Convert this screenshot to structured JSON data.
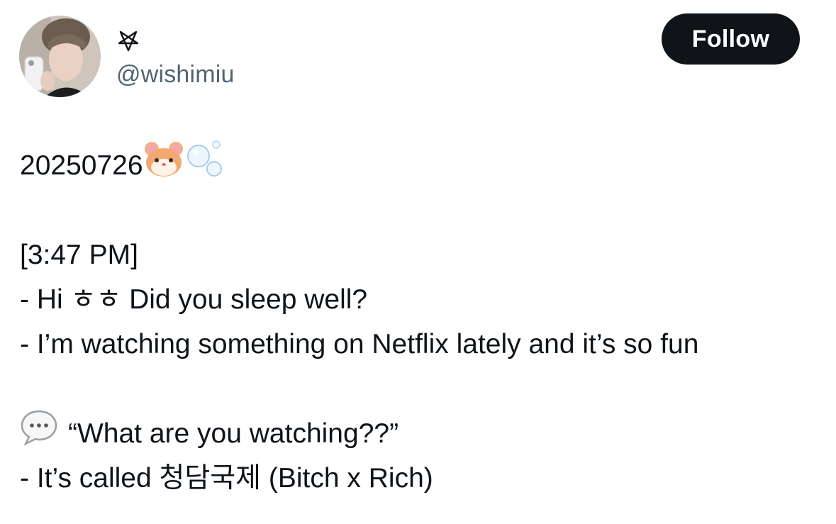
{
  "user": {
    "display_name": "⛤",
    "handle": "@wishimiu",
    "follow_label": "Follow"
  },
  "tweet": {
    "date": "20250726",
    "date_emojis": [
      "hamster-face-icon",
      "bubbles-icon"
    ],
    "time": "[3:47 PM]",
    "line1": "- Hi ㅎㅎ Did you sleep well?",
    "line2": "- I’m watching something on Netflix lately and it’s so fun",
    "quote": "“What are you watching??”",
    "quote_icon": "speech-bubble-icon",
    "line3": "- It’s called 청담국제 (Bitch x Rich)"
  },
  "colors": {
    "text": "#0f1419",
    "secondary": "#536471",
    "button_bg": "#0f1419",
    "button_text": "#ffffff"
  }
}
